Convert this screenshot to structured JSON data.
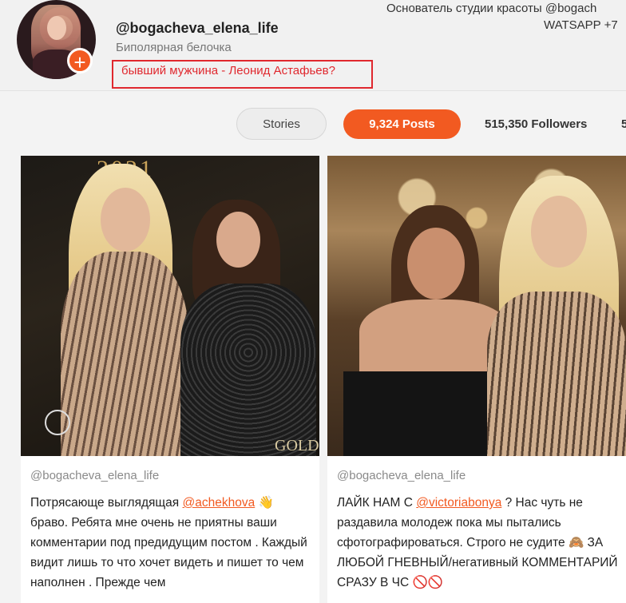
{
  "profile": {
    "username": "@bogacheva_elena_life",
    "subtitle": "Биполярная белочка",
    "highlight": "бывший мужчина - Леонид Астафьев?",
    "bio_line1": "Основатель студии красоты @bogach",
    "bio_line2": "WATSAPP +7",
    "add_icon": "plus-icon"
  },
  "tabs": {
    "stories": "Stories",
    "posts": "9,324 Posts",
    "followers": "515,350 Followers",
    "following_cut": "5"
  },
  "colors": {
    "accent": "#f25a21",
    "highlight": "#e0282e"
  },
  "posts": [
    {
      "author": "@bogacheva_elena_life",
      "photo_text_top": "2021",
      "photo_text_bottom": "GOLDE",
      "text_before": "Потрясающе выглядящая ",
      "mention": "@achekhova",
      "text_after": " 👋 браво. Ребята мне очень не приятны ваши комментарии под предидущим постом . Каждый видит лишь то что хочет видеть и пишет то чем наполнен . Прежде чем"
    },
    {
      "author": "@bogacheva_elena_life",
      "text_before": "ЛАЙК НАМ С ",
      "mention": "@victoriabonya",
      "text_after": " ? Нас чуть не раздавила молодеж пока мы пытались сфотографироваться. Строго не судите 🙈 ЗА ЛЮБОЙ ГНЕВНЫЙ/негативный КОММЕНТАРИЙ СРАЗУ В ЧС 🚫🚫"
    }
  ]
}
